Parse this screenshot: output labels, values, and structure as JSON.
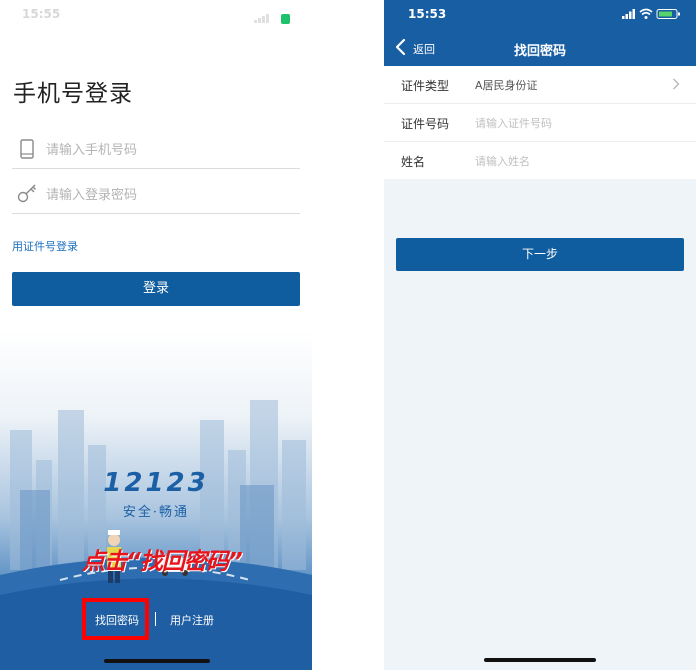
{
  "left_screen": {
    "status_time": "15:55",
    "title": "手机号登录",
    "phone_field": {
      "placeholder": "请输入手机号码",
      "icon": "phone-icon"
    },
    "password_field": {
      "placeholder": "请输入登录密码",
      "icon": "key-icon"
    },
    "id_login_link": "用证件号登录",
    "login_button": "登录",
    "brand": {
      "logo_text": "12123",
      "slogan": "安全·畅通"
    },
    "annotation": "点击“找回密码”",
    "find_password_link": "找回密码",
    "register_link": "用户注册",
    "colors": {
      "primary": "#0f5c9e",
      "link": "#1a6fbf",
      "annotation": "#e8141c",
      "highlight": "#ff0000"
    }
  },
  "right_screen": {
    "status_time": "15:53",
    "nav": {
      "back_label": "返回",
      "title": "找回密码"
    },
    "form": [
      {
        "label": "证件类型",
        "value": "A居民身份证",
        "is_placeholder": false,
        "has_chevron": true
      },
      {
        "label": "证件号码",
        "value": "请输入证件号码",
        "is_placeholder": true,
        "has_chevron": false
      },
      {
        "label": "姓名",
        "value": "请输入姓名",
        "is_placeholder": true,
        "has_chevron": false
      }
    ],
    "next_button": "下一步",
    "colors": {
      "header": "#175ea3",
      "background": "#eff4f8"
    }
  }
}
